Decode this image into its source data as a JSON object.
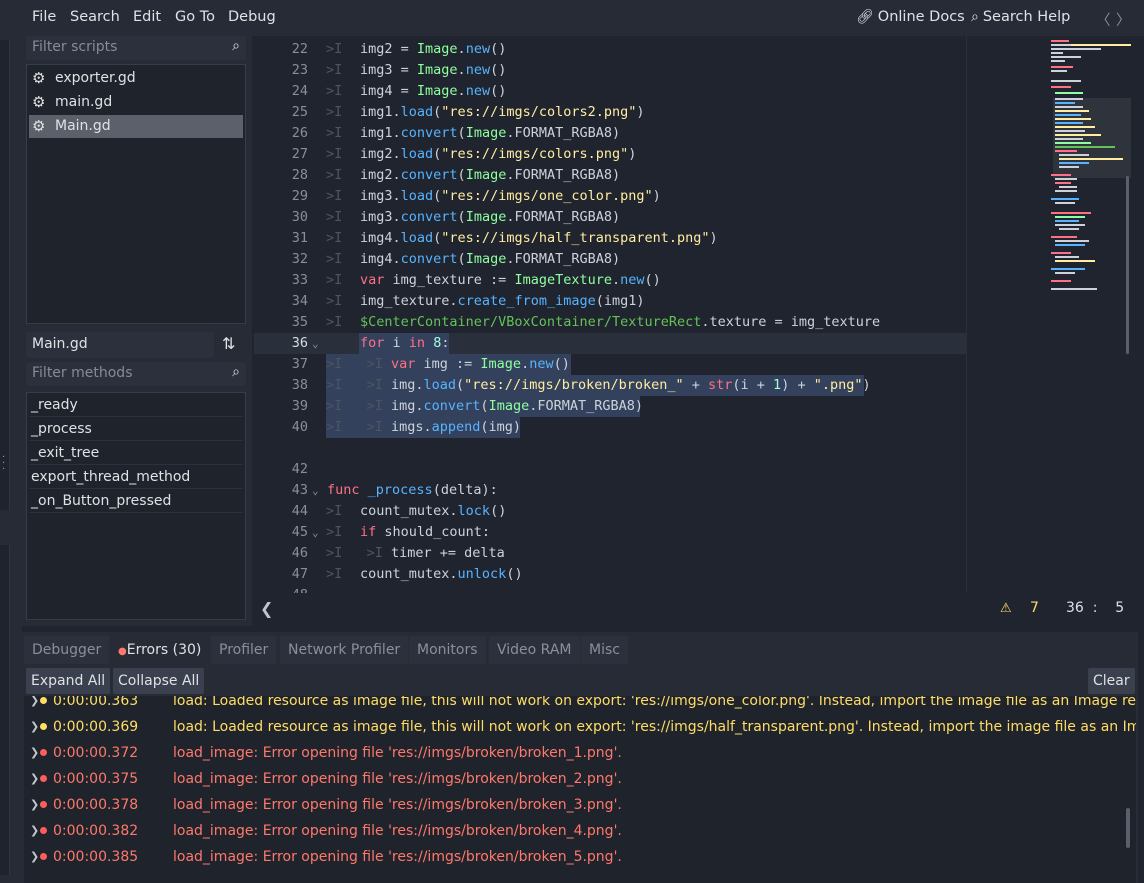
{
  "menu": {
    "items": [
      "File",
      "Search",
      "Edit",
      "Go To",
      "Debug"
    ],
    "online_docs": "Online Docs",
    "search_help": "Search Help"
  },
  "scripts": {
    "filter_placeholder": "Filter scripts",
    "items": [
      "exporter.gd",
      "main.gd",
      "Main.gd"
    ],
    "selected": "Main.gd"
  },
  "methods": {
    "current_script": "Main.gd",
    "filter_placeholder": "Filter methods",
    "items": [
      "_ready",
      "_process",
      "_exit_tree",
      "export_thread_method",
      "_on_Button_pressed"
    ]
  },
  "editor": {
    "warning_count": "7",
    "cursor_line": "36",
    "cursor_col": "5"
  },
  "bottom_tabs": [
    "Debugger",
    "Errors (30)",
    "Profiler",
    "Network Profiler",
    "Monitors",
    "Video RAM",
    "Misc"
  ],
  "bottom_buttons": {
    "expand": "Expand All",
    "collapse": "Collapse All",
    "clear": "Clear"
  },
  "errors": [
    {
      "type": "warn",
      "time": "0:00:00.363",
      "msg": "load: Loaded resource as image file, this will not work on export: 'res://imgs/one_color.png'. Instead, import the image file as an Image reso"
    },
    {
      "type": "warn",
      "time": "0:00:00.369",
      "msg": "load: Loaded resource as image file, this will not work on export: 'res://imgs/half_transparent.png'. Instead, import the image file as an Ima"
    },
    {
      "type": "error",
      "time": "0:00:00.372",
      "msg": "load_image: Error opening file 'res://imgs/broken/broken_1.png'."
    },
    {
      "type": "error",
      "time": "0:00:00.375",
      "msg": "load_image: Error opening file 'res://imgs/broken/broken_2.png'."
    },
    {
      "type": "error",
      "time": "0:00:00.378",
      "msg": "load_image: Error opening file 'res://imgs/broken/broken_3.png'."
    },
    {
      "type": "error",
      "time": "0:00:00.382",
      "msg": "load_image: Error opening file 'res://imgs/broken/broken_4.png'."
    },
    {
      "type": "error",
      "time": "0:00:00.385",
      "msg": "load_image: Error opening file 'res://imgs/broken/broken_5.png'."
    }
  ]
}
